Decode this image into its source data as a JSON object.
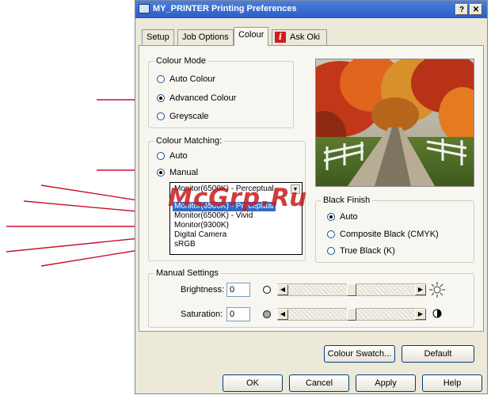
{
  "window": {
    "title": "MY_PRINTER Printing Preferences",
    "help_glyph": "?",
    "close_glyph": "✕"
  },
  "tabs": [
    {
      "label": "Setup",
      "active": false
    },
    {
      "label": "Job Options",
      "active": false
    },
    {
      "label": "Colour",
      "active": true
    },
    {
      "label": "Ask Oki",
      "active": false
    }
  ],
  "ask_oki_badge": "i",
  "colour_mode": {
    "legend": "Colour Mode",
    "options": [
      {
        "label": "Auto Colour",
        "checked": false
      },
      {
        "label": "Advanced Colour",
        "checked": true
      },
      {
        "label": "Greyscale",
        "checked": false
      }
    ]
  },
  "colour_matching": {
    "legend": "Colour Matching:",
    "options": [
      {
        "label": "Auto",
        "checked": false
      },
      {
        "label": "Manual",
        "checked": true
      }
    ],
    "dropdown": {
      "selected": "Monitor(6500K) - Perceptual",
      "items": [
        {
          "label": "Monitor(6500K) - Perceptual",
          "highlighted": false
        },
        {
          "label": "Monitor(6500K) - Perceptual",
          "highlighted": true
        },
        {
          "label": "Monitor(6500K) - Vivid",
          "highlighted": false
        },
        {
          "label": "Monitor(9300K)",
          "highlighted": false
        },
        {
          "label": "Digital Camera",
          "highlighted": false
        },
        {
          "label": "sRGB",
          "highlighted": false
        }
      ]
    }
  },
  "black_finish": {
    "legend": "Black Finish",
    "options": [
      {
        "label": "Auto",
        "checked": true
      },
      {
        "label": "Composite Black (CMYK)",
        "checked": false
      },
      {
        "label": "True Black (K)",
        "checked": false
      }
    ]
  },
  "manual_settings": {
    "legend": "Manual Settings",
    "brightness": {
      "label": "Brightness:",
      "value": "0",
      "level": 0.5
    },
    "saturation": {
      "label": "Saturation:",
      "value": "0",
      "level": 0.5
    }
  },
  "buttons": {
    "colour_swatch": "Colour Swatch...",
    "default": "Default",
    "ok": "OK",
    "cancel": "Cancel",
    "apply": "Apply",
    "help": "Help"
  },
  "watermark": "McGrp.Ru",
  "colors": {
    "title_bar": "#2b5cc6",
    "selection": "#316ac5",
    "callout_line": "#c8102e",
    "watermark": "#c61d1d"
  }
}
